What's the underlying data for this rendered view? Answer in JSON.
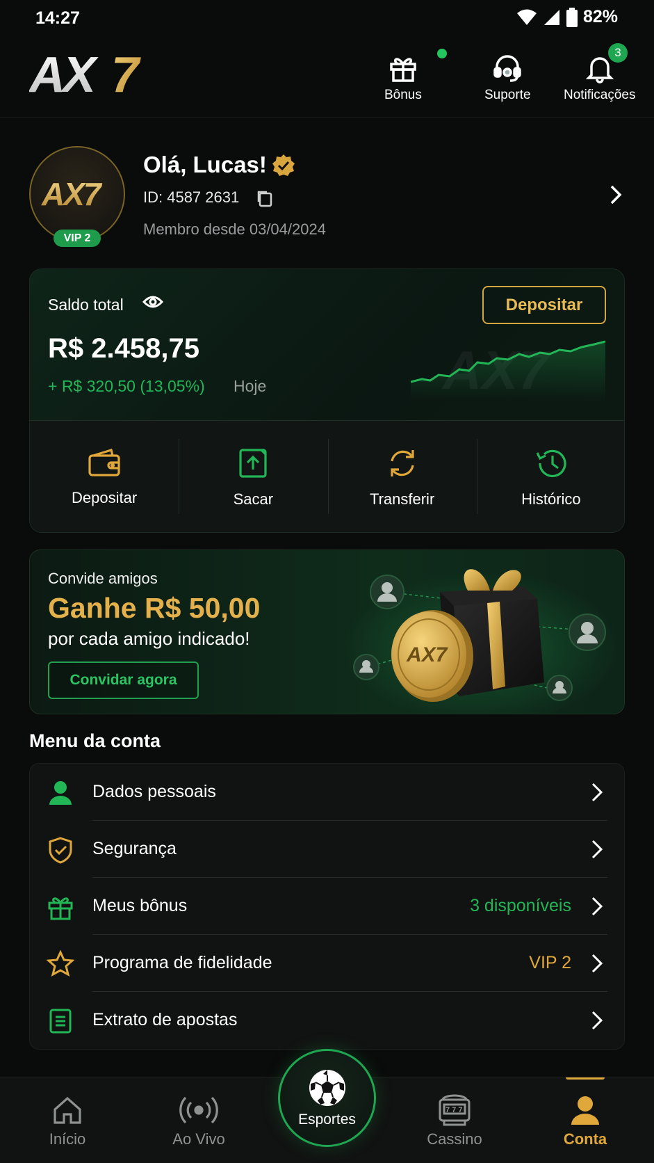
{
  "status_bar": {
    "time": "14:27",
    "battery": "82%"
  },
  "header": {
    "logo_text": "AX7",
    "actions": [
      {
        "label": "Bônus",
        "icon": "gift-icon",
        "dot": true
      },
      {
        "label": "Suporte",
        "icon": "headset-icon"
      },
      {
        "label": "Notificações",
        "icon": "bell-icon",
        "badge": "3"
      }
    ]
  },
  "profile": {
    "avatar_text": "AX7",
    "vip": "VIP 2",
    "greeting": "Olá, Lucas!",
    "id": "ID: 4587 2631",
    "member_since": "Membro desde 03/04/2024"
  },
  "balance": {
    "label": "Saldo total",
    "deposit_button": "Depositar",
    "amount": "R$ 2.458,75",
    "change": "+ R$ 320,50 (13,05%)",
    "period": "Hoje",
    "actions": [
      {
        "label": "Depositar",
        "icon": "wallet-icon"
      },
      {
        "label": "Sacar",
        "icon": "withdraw-icon"
      },
      {
        "label": "Transferir",
        "icon": "transfer-icon"
      },
      {
        "label": "Histórico",
        "icon": "history-icon"
      }
    ]
  },
  "referral": {
    "subtitle": "Convide amigos",
    "title": "Ganhe R$ 50,00",
    "description": "por cada amigo indicado!",
    "button": "Convidar agora",
    "coin_text": "AX7"
  },
  "menu": {
    "title": "Menu da conta",
    "items": [
      {
        "label": "Dados pessoais",
        "icon": "user-icon",
        "extra": ""
      },
      {
        "label": "Segurança",
        "icon": "shield-check-icon",
        "extra": ""
      },
      {
        "label": "Meus bônus",
        "icon": "gift-icon",
        "extra": "3 disponíveis",
        "extra_color": "#22b657"
      },
      {
        "label": "Programa de fidelidade",
        "icon": "star-icon",
        "extra": "VIP 2",
        "extra_color": "#e0a83a"
      },
      {
        "label": "Extrato de apostas",
        "icon": "document-icon",
        "extra": ""
      }
    ]
  },
  "bottom_nav": {
    "items": [
      {
        "label": "Início",
        "icon": "home-icon"
      },
      {
        "label": "Ao Vivo",
        "icon": "live-icon"
      },
      {
        "label": "Esportes",
        "icon": "soccer-ball-icon"
      },
      {
        "label": "Cassino",
        "icon": "slot-machine-icon"
      },
      {
        "label": "Conta",
        "icon": "user-icon",
        "active": true
      }
    ]
  },
  "colors": {
    "accent_gold": "#e0a83a",
    "accent_green": "#22b657",
    "background": "#0a0b0b"
  }
}
